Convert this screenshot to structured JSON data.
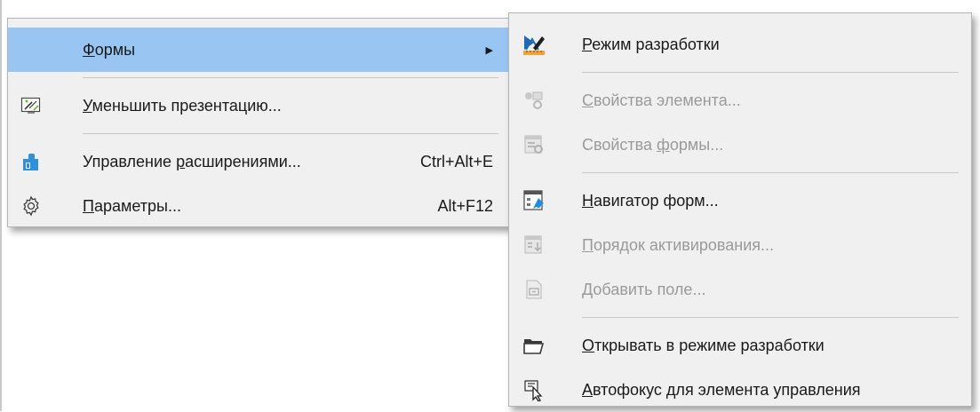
{
  "main_menu": {
    "items": [
      {
        "label": "Формы",
        "accel": "Ф",
        "rest": "ормы",
        "shortcut": "",
        "submenu_arrow": "▶",
        "icon": "none",
        "highlighted": true
      },
      {
        "label": "Уменьшить презентацию...",
        "accel": "У",
        "rest": "меньшить презентацию...",
        "shortcut": "",
        "icon": "minimize-presentation-icon"
      },
      {
        "label": "Управление расширениями...",
        "pre": "Управление ",
        "accel": "р",
        "rest": "асширениями...",
        "shortcut": "Ctrl+Alt+E",
        "icon": "extension-manager-icon"
      },
      {
        "label": "Параметры...",
        "accel": "П",
        "rest": "араметры...",
        "shortcut": "Alt+F12",
        "icon": "gear-icon"
      }
    ]
  },
  "forms_submenu": {
    "items": [
      {
        "label": "Режим разработки",
        "accel": "Р",
        "rest": "ежим разработки",
        "enabled": true,
        "icon": "design-mode-icon"
      },
      {
        "label": "Свойства элемента...",
        "accel": "С",
        "rest": "войства элемента...",
        "enabled": false,
        "icon": "control-properties-icon"
      },
      {
        "label": "Свойства формы...",
        "pre": "Свойства ",
        "accel": "ф",
        "rest": "ормы...",
        "enabled": false,
        "icon": "form-properties-icon"
      },
      {
        "label": "Навигатор форм...",
        "accel": "Н",
        "rest": "авигатор форм...",
        "enabled": true,
        "icon": "form-navigator-icon"
      },
      {
        "label": "Порядок активирования...",
        "accel": "П",
        "rest": "орядок активирования...",
        "enabled": false,
        "icon": "tab-order-icon"
      },
      {
        "label": "Добавить поле...",
        "accel": "Д",
        "rest": "обавить поле...",
        "enabled": false,
        "icon": "add-field-icon"
      },
      {
        "label": "Открывать в режиме разработки",
        "accel": "О",
        "rest": "ткрывать в режиме разработки",
        "enabled": true,
        "icon": "open-folder-icon"
      },
      {
        "label": "Автофокус для элемента управления",
        "accel": "А",
        "rest": "втофокус для элемента управления",
        "enabled": true,
        "icon": "autofocus-icon"
      }
    ]
  },
  "colors": {
    "menu_background": "#f0f0f0",
    "highlight": "#98c5f2",
    "disabled_text": "#9a9a9a",
    "separator": "#c8c8c8"
  }
}
